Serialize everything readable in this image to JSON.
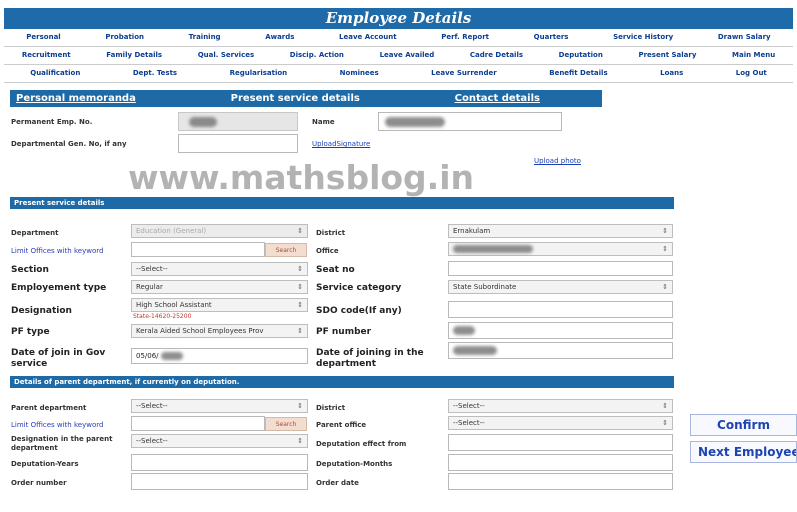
{
  "header": {
    "title": "Employee Details"
  },
  "menu": {
    "row1": [
      "Personal",
      "Probation",
      "Training",
      "Awards",
      "Leave Account",
      "Perf. Report",
      "Quarters",
      "Service History",
      "Drawn Salary"
    ],
    "row2": [
      "Recruitment",
      "Family Details",
      "Qual. Services",
      "Discip. Action",
      "Leave Availed",
      "Cadre Details",
      "Deputation",
      "Present Salary",
      "Main Menu"
    ],
    "row3": [
      "Qualification",
      "Dept. Tests",
      "Regularisation",
      "Nominees",
      "Leave Surrender",
      "Benefit Details",
      "Loans",
      "Log Out"
    ]
  },
  "tabs": {
    "personal": "Personal memoranda",
    "service": "Present service details",
    "contact": "Contact details"
  },
  "top_form": {
    "pen_label": "Permanent Emp. No.",
    "name_label": "Name",
    "dept_gen_label": "Departmental Gen. No, if any",
    "upload_signature": "UploadSignature",
    "upload_photo": "Upload photo"
  },
  "watermark": "www.mathsblog.in",
  "present": {
    "section_title": "Present service details",
    "department_label": "Department",
    "department_value": "Education (General)",
    "limit_offices": "Limit Offices with keyword",
    "search": "Search",
    "section_label": "Section",
    "section_value": "--Select--",
    "emp_type_label": "Employement type",
    "emp_type_value": "Regular",
    "designation_label": "Designation",
    "designation_value": "High School Assistant",
    "designation_note": "State-14620-25200",
    "pf_type_label": "PF type",
    "pf_type_value": "Kerala Aided School Employees Prov",
    "doj_gov_label": "Date of join in Gov service",
    "doj_gov_value": "05/06/",
    "district_label": "District",
    "district_value": "Ernakulam",
    "office_label": "Office",
    "seat_label": "Seat no",
    "category_label": "Service category",
    "category_value": "State Subordinate",
    "sdo_label": "SDO code(If any)",
    "pf_number_label": "PF number",
    "doj_dept_label": "Date of joining in the department"
  },
  "parent": {
    "section_title": "Details of parent department, if currently on deputation.",
    "parent_dept_label": "Parent department",
    "parent_dept_value": "--Select--",
    "limit_offices": "Limit Offices with keyword",
    "search": "Search",
    "designation_label": "Designation in the parent department",
    "designation_value": "--Select--",
    "dep_years_label": "Deputation-Years",
    "order_number_label": "Order number",
    "district_label": "District",
    "district_value": "--Select--",
    "parent_office_label": "Parent office",
    "parent_office_value": "--Select--",
    "dep_effect_label": "Deputation effect from",
    "dep_months_label": "Deputation-Months",
    "order_date_label": "Order date"
  },
  "buttons": {
    "confirm": "Confirm",
    "next_employee": "Next Employee"
  },
  "colors": {
    "header_blue": "#1f6aa8",
    "menu_text": "#0b3d91",
    "button_text": "#1d44b0"
  }
}
